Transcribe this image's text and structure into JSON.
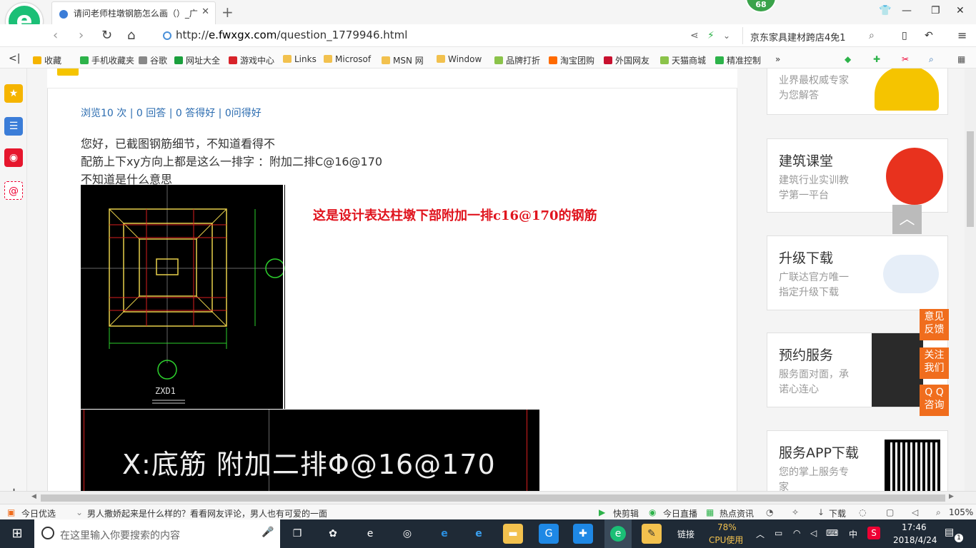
{
  "browser": {
    "logo_text": "e",
    "tab_title": "请问老师柱墩钢筋怎么画（）_广",
    "notification_badge": "68",
    "url_domain": "e.fwxgx.com",
    "url_prefix": "http://",
    "url_path": "/question_1779946.html",
    "search_value": "京东家具建材跨店4免1"
  },
  "bookmarks": [
    {
      "label": "收藏",
      "color": "#f5b400"
    },
    {
      "label": "手机收藏夹",
      "color": "#2db34a"
    },
    {
      "label": "谷歌",
      "color": "#888888"
    },
    {
      "label": "网址大全",
      "color": "#1a9f3c"
    },
    {
      "label": "游戏中心",
      "color": "#d8232a"
    },
    {
      "label": "Links",
      "color": "#f2c14e"
    },
    {
      "label": "Microsof",
      "color": "#f2c14e"
    },
    {
      "label": "MSN 网",
      "color": "#f2c14e"
    },
    {
      "label": "Window",
      "color": "#f2c14e"
    },
    {
      "label": "品牌打折",
      "color": "#8bc34a"
    },
    {
      "label": "淘宝团购",
      "color": "#ff6a00"
    },
    {
      "label": "外国网友",
      "color": "#c8102e"
    },
    {
      "label": "天猫商城",
      "color": "#8bc34a"
    },
    {
      "label": "精准控制",
      "color": "#2db34a"
    }
  ],
  "question": {
    "stats": "浏览10 次 | 0 回答 | 0 答得好 | 0问得好",
    "line1": "您好，已截图钢筋细节，不知道看得不",
    "line2": "配筋上下xy方向上都是这么一排字 ：附加二排C@16@170",
    "line3": "不知道是什么意思",
    "annotation": "这是设计表达柱墩下部附加一排c16@170的钢筋",
    "cad_label": "ZXD1",
    "cad_zoom_text": "X:底筋 附加二排Φ@16@170"
  },
  "cards": [
    {
      "title": "",
      "sub1": "业界最权威专家",
      "sub2": "为您解答"
    },
    {
      "title": "建筑课堂",
      "sub1": "建筑行业实训教",
      "sub2": "学第一平台"
    },
    {
      "title": "升级下载",
      "sub1": "广联达官方唯一",
      "sub2": "指定升级下载"
    },
    {
      "title": "预约服务",
      "sub1": "服务面对面，承",
      "sub2": "诺心连心"
    },
    {
      "title": "服务APP下载",
      "sub1": "您的掌上服务专",
      "sub2": "家"
    }
  ],
  "float_buttons": [
    {
      "l1": "意见",
      "l2": "反馈"
    },
    {
      "l1": "关注",
      "l2": "我们"
    },
    {
      "l1": "Q Q",
      "l2": "咨询"
    }
  ],
  "statusbar": {
    "today": "今日优选",
    "news": "男人撒娇起来是什么样的？看看网友评论，男人也有可爱的一面",
    "kuaijian": "快剪辑",
    "live": "今日直播",
    "hot": "热点资讯",
    "download": "下载",
    "zoom": "105%"
  },
  "taskbar": {
    "search_placeholder": "在这里输入你要搜索的内容",
    "links": "链接",
    "cpu_pct": "78%",
    "cpu_label": "CPU使用",
    "ime": "中",
    "time": "17:46",
    "date": "2018/4/24",
    "notif_count": "1"
  }
}
